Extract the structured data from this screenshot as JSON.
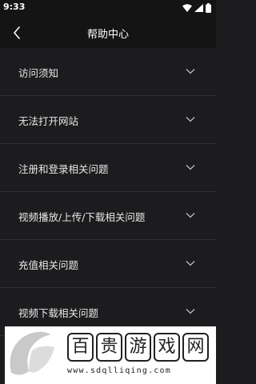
{
  "status_bar": {
    "time": "9:33",
    "icons": [
      "wifi-icon",
      "signal-icon",
      "battery-icon"
    ]
  },
  "header": {
    "title": "帮助中心",
    "back_icon": "chevron-left-icon"
  },
  "faq_items": [
    {
      "label": "访问须知"
    },
    {
      "label": "无法打开网站"
    },
    {
      "label": "注册和登录相关问题"
    },
    {
      "label": "视频播放/上传/下载相关问题"
    },
    {
      "label": "充值相关问题"
    },
    {
      "label": "视频下载相关问题"
    }
  ],
  "watermark": {
    "chars": [
      "百",
      "贵",
      "游",
      "戏",
      "网"
    ],
    "url": "www.sdqlliqing.com"
  },
  "colors": {
    "background": "#1c1c1e",
    "bar": "#141414",
    "divider": "#303030",
    "text": "#e8e8e8",
    "watermark_accent": "#c9c9c9"
  }
}
